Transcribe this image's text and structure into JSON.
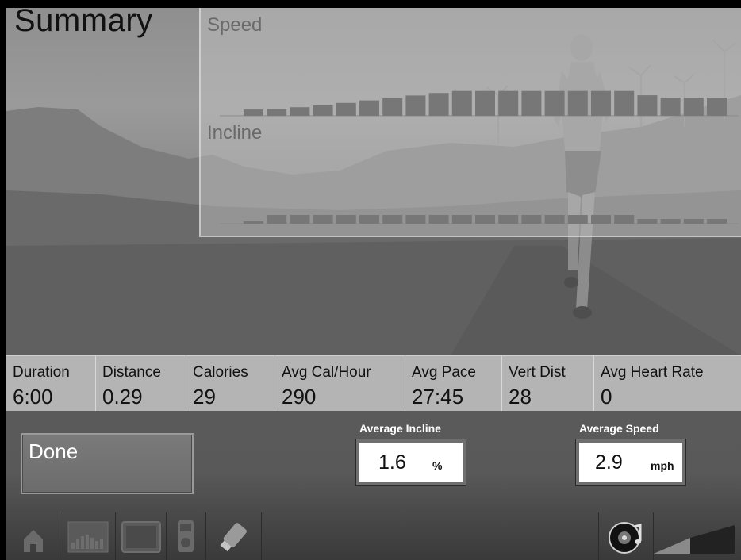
{
  "page": {
    "title": "Summary"
  },
  "graphs": {
    "speed_label": "Speed",
    "incline_label": "Incline",
    "speed_levels": [
      0.22,
      0.25,
      0.3,
      0.36,
      0.45,
      0.54,
      0.62,
      0.71,
      0.8,
      0.87,
      0.87,
      0.87,
      0.87,
      0.87,
      0.87,
      0.87,
      0.87,
      0.72,
      0.64,
      0.64,
      0.64
    ],
    "incline_levels": [
      0.15,
      0.55,
      0.55,
      0.55,
      0.55,
      0.55,
      0.55,
      0.55,
      0.55,
      0.55,
      0.55,
      0.55,
      0.55,
      0.55,
      0.55,
      0.55,
      0.55,
      0.3,
      0.3,
      0.3,
      0.3
    ]
  },
  "stats": {
    "duration": {
      "label": "Duration",
      "value": "6:00"
    },
    "distance": {
      "label": "Distance",
      "value": "0.29"
    },
    "calories": {
      "label": "Calories",
      "value": "29"
    },
    "avg_cal_hour": {
      "label": "Avg Cal/Hour",
      "value": "290"
    },
    "avg_pace": {
      "label": "Avg Pace",
      "value": "27:45"
    },
    "vert_dist": {
      "label": "Vert Dist",
      "value": "28"
    },
    "avg_heart_rate": {
      "label": "Avg Heart Rate",
      "value": "0"
    }
  },
  "controls": {
    "done_label": "Done",
    "average_incline": {
      "title": "Average Incline",
      "value": "1.6",
      "unit": "%"
    },
    "average_speed": {
      "title": "Average Speed",
      "value": "2.9",
      "unit": "mph"
    }
  },
  "nav": {
    "icons": [
      "home-icon",
      "workout-profile-icon",
      "tv-screen-icon",
      "ipod-icon",
      "usb-drive-icon",
      "speaker-icon",
      "volume-level-icon"
    ]
  },
  "colors": {
    "bar": "#777777",
    "panel_text": "#6a6a6a",
    "stats_bg": "#b4b4b4"
  }
}
